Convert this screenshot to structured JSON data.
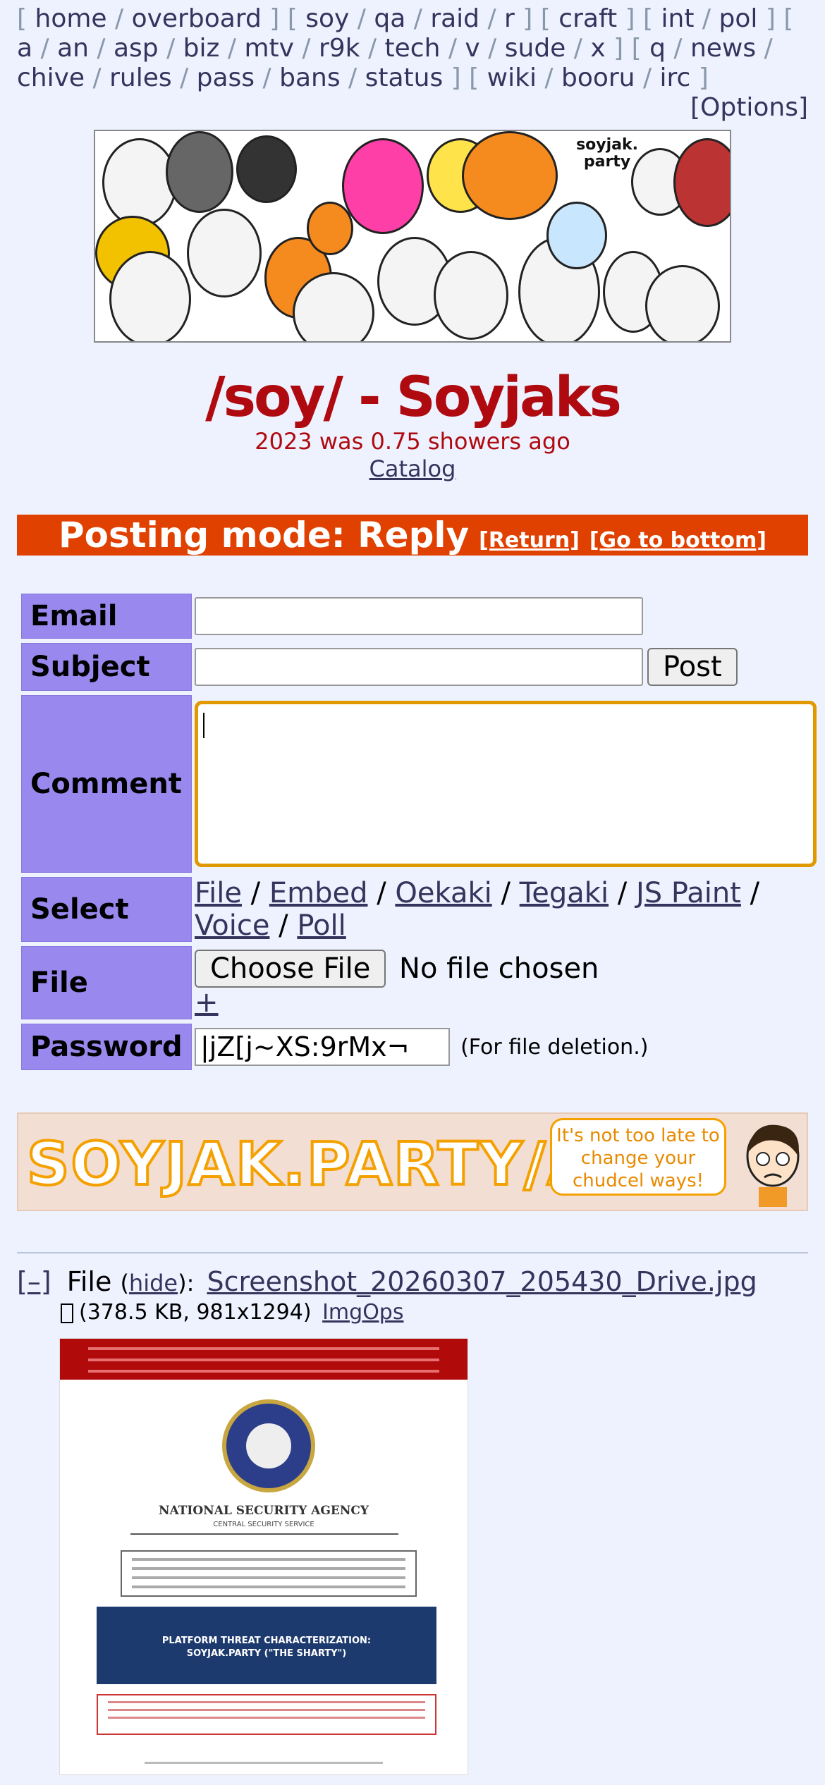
{
  "nav": {
    "groups": [
      [
        "home",
        "overboard"
      ],
      [
        "soy",
        "qa",
        "raid",
        "r"
      ],
      [
        "craft"
      ],
      [
        "int",
        "pol"
      ],
      [
        "a",
        "an",
        "asp",
        "biz",
        "mtv",
        "r9k",
        "tech",
        "v",
        "sude",
        "x"
      ],
      [
        "q",
        "news",
        "chive",
        "rules",
        "pass",
        "bans",
        "status"
      ],
      [
        "wiki",
        "booru",
        "irc"
      ]
    ],
    "options": "[Options]"
  },
  "banner": {
    "brand_text": "soyjak.\nparty"
  },
  "board": {
    "title": "/soy/ - Soyjaks",
    "subtitle": "2023 was 0.75 showers ago",
    "catalog": "Catalog"
  },
  "posting_mode": {
    "text": "Posting mode: Reply",
    "return": "[Return]",
    "bottom": "[Go to bottom]"
  },
  "form": {
    "email_label": "Email",
    "subject_label": "Subject",
    "post_button": "Post",
    "comment_label": "Comment",
    "select_label": "Select",
    "select_options": [
      "File",
      "Embed",
      "Oekaki",
      "Tegaki",
      "JS Paint",
      "Voice",
      "Poll"
    ],
    "file_label": "File",
    "choose_file": "Choose File",
    "no_file": "No file chosen",
    "add_more": "+",
    "password_label": "Password",
    "password_value": "|jZ[j~XS:9rMx¬",
    "password_note": "(For file deletion.)"
  },
  "ad": {
    "text": "SOYJAK.PARTY/A",
    "bubble": "It's not too late to change your chudcel ways!"
  },
  "file": {
    "toggle": "[–]",
    "label": "File",
    "hide": "hide",
    "filename": "Screenshot_20260307_205430_Drive.jpg",
    "meta": "(378.5 KB, 981x1294)",
    "imgops": "ImgOps"
  },
  "document_image": {
    "agency": "NATIONAL SECURITY AGENCY",
    "service": "CENTRAL SECURITY SERVICE",
    "heading": "PLATFORM THREAT CHARACTERIZATION:\nSOYJAK.PARTY (\"THE SHARTY\")"
  },
  "colors": {
    "background": "#eef2ff",
    "title_red": "#af0a0f",
    "posting_mode_bg": "#e04000",
    "label_purple": "#9988ee",
    "link": "#34345c",
    "focus_outline": "#e09900"
  }
}
